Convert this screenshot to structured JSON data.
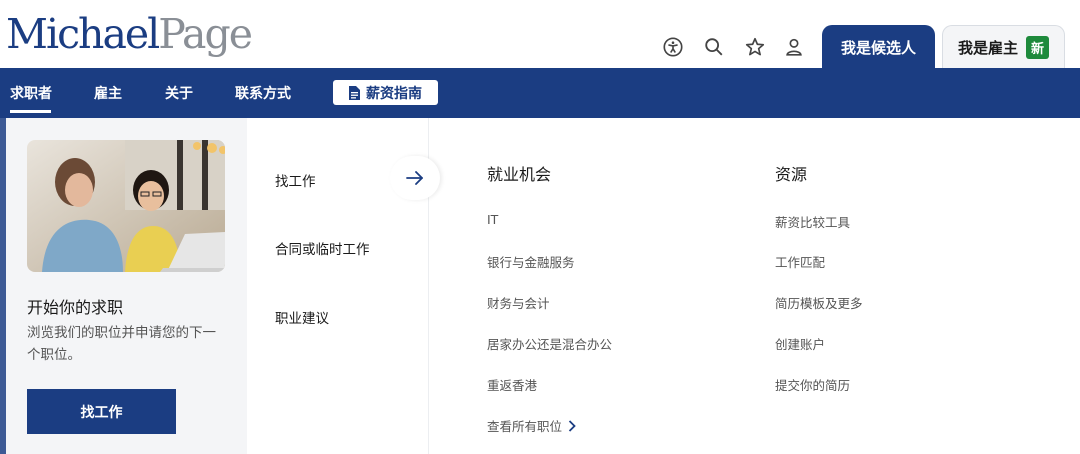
{
  "brand": {
    "logo_part1": "Michael",
    "logo_part2": "Page"
  },
  "header": {
    "icons": [
      "accessibility-icon",
      "search-icon",
      "star-icon",
      "user-icon"
    ],
    "tab_candidate": "我是候选人",
    "tab_employer": "我是雇主",
    "badge_new": "新"
  },
  "nav": {
    "items": [
      "求职者",
      "雇主",
      "关于",
      "联系方式"
    ],
    "salary_guide": "薪资指南"
  },
  "menu": {
    "left": {
      "title": "开始你的求职",
      "description": "浏览我们的职位并申请您的下一个职位。",
      "button": "找工作"
    },
    "mid": {
      "items": [
        "找工作",
        "合同或临时工作",
        "职业建议"
      ]
    },
    "jobs": {
      "title": "就业机会",
      "links": [
        "IT",
        "银行与金融服务",
        "财务与会计",
        "居家办公还是混合办公",
        "重返香港"
      ],
      "see_all": "查看所有职位"
    },
    "resources": {
      "title": "资源",
      "links": [
        "薪资比较工具",
        "工作匹配",
        "简历模板及更多",
        "创建账户",
        "提交你的简历"
      ]
    }
  },
  "colors": {
    "primary": "#1b3d82",
    "badge_green": "#1e8a3c",
    "panel_grey": "#f4f5f7"
  }
}
